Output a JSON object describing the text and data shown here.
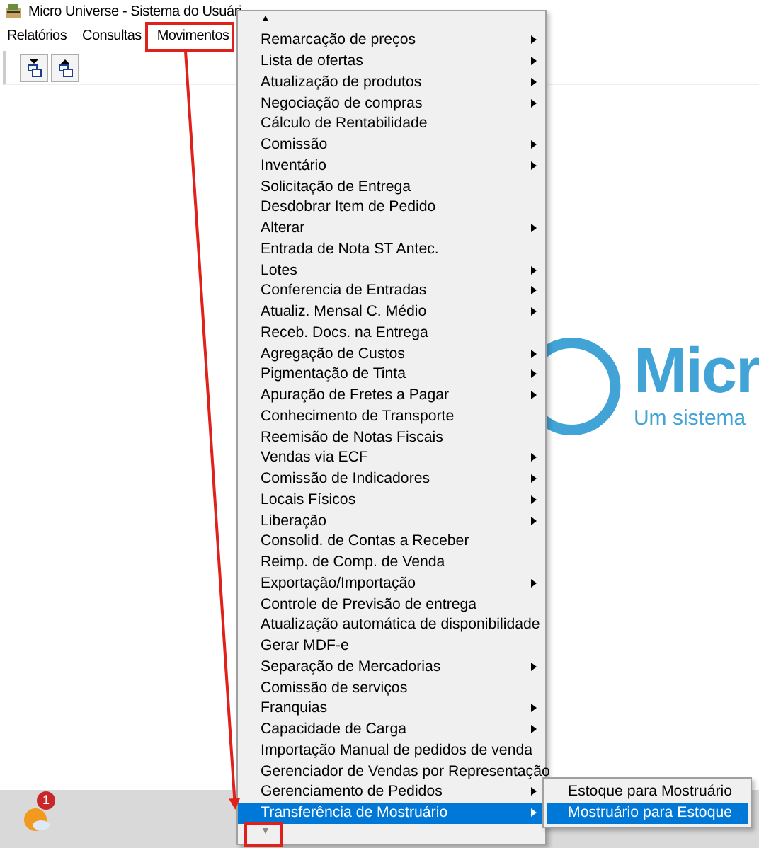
{
  "window": {
    "title": "Micro Universe - Sistema do Usuári"
  },
  "menu_bar": [
    {
      "label": "Relatórios"
    },
    {
      "label": "Consultas"
    },
    {
      "label": "Movimentos"
    }
  ],
  "logo": {
    "name": "Micr",
    "tagline": "Um sistema"
  },
  "dropdown": {
    "scroll_up": "▲",
    "scroll_down": "▼",
    "items": [
      {
        "label": "Remarcação de preços",
        "submenu": true,
        "selected": false
      },
      {
        "label": "Lista de ofertas",
        "submenu": true,
        "selected": false
      },
      {
        "label": "Atualização de produtos",
        "submenu": true,
        "selected": false
      },
      {
        "label": "Negociação de compras",
        "submenu": true,
        "selected": false
      },
      {
        "label": "Cálculo de Rentabilidade",
        "submenu": false,
        "selected": false
      },
      {
        "label": "Comissão",
        "submenu": true,
        "selected": false
      },
      {
        "label": "Inventário",
        "submenu": true,
        "selected": false
      },
      {
        "label": "Solicitação de Entrega",
        "submenu": false,
        "selected": false
      },
      {
        "label": "Desdobrar Item de Pedido",
        "submenu": false,
        "selected": false
      },
      {
        "label": "Alterar",
        "submenu": true,
        "selected": false
      },
      {
        "label": "Entrada de Nota ST Antec.",
        "submenu": false,
        "selected": false
      },
      {
        "label": "Lotes",
        "submenu": true,
        "selected": false
      },
      {
        "label": "Conferencia de Entradas",
        "submenu": true,
        "selected": false
      },
      {
        "label": "Atualiz. Mensal C. Médio",
        "submenu": true,
        "selected": false
      },
      {
        "label": "Receb. Docs. na Entrega",
        "submenu": false,
        "selected": false
      },
      {
        "label": "Agregação de Custos",
        "submenu": true,
        "selected": false
      },
      {
        "label": "Pigmentação de Tinta",
        "submenu": true,
        "selected": false
      },
      {
        "label": "Apuração de Fretes a Pagar",
        "submenu": true,
        "selected": false
      },
      {
        "label": "Conhecimento de Transporte",
        "submenu": false,
        "selected": false
      },
      {
        "label": "Reemisão de Notas Fiscais",
        "submenu": false,
        "selected": false
      },
      {
        "label": "Vendas via ECF",
        "submenu": true,
        "selected": false
      },
      {
        "label": "Comissão de Indicadores",
        "submenu": true,
        "selected": false
      },
      {
        "label": "Locais Físicos",
        "submenu": true,
        "selected": false
      },
      {
        "label": "Liberação",
        "submenu": true,
        "selected": false
      },
      {
        "label": "Consolid. de Contas a Receber",
        "submenu": false,
        "selected": false
      },
      {
        "label": "Reimp. de Comp. de Venda",
        "submenu": false,
        "selected": false
      },
      {
        "label": "Exportação/Importação",
        "submenu": true,
        "selected": false
      },
      {
        "label": "Controle de Previsão de entrega",
        "submenu": false,
        "selected": false
      },
      {
        "label": "Atualização automática de disponibilidade",
        "submenu": false,
        "selected": false
      },
      {
        "label": "Gerar MDF-e",
        "submenu": false,
        "selected": false
      },
      {
        "label": "Separação de Mercadorias",
        "submenu": true,
        "selected": false
      },
      {
        "label": "Comissão de serviços",
        "submenu": false,
        "selected": false
      },
      {
        "label": "Franquias",
        "submenu": true,
        "selected": false
      },
      {
        "label": "Capacidade de Carga",
        "submenu": true,
        "selected": false
      },
      {
        "label": "Importação Manual de pedidos de venda",
        "submenu": false,
        "selected": false
      },
      {
        "label": "Gerenciador de Vendas por Representação",
        "submenu": false,
        "selected": false
      },
      {
        "label": "Gerenciamento de Pedidos",
        "submenu": true,
        "selected": false
      },
      {
        "label": "Transferência de Mostruário",
        "submenu": true,
        "selected": true
      }
    ]
  },
  "submenu": {
    "items": [
      {
        "label": "Estoque para Mostruário",
        "selected": false
      },
      {
        "label": "Mostruário para Estoque",
        "selected": true
      }
    ]
  },
  "tray": {
    "badge": "1"
  }
}
